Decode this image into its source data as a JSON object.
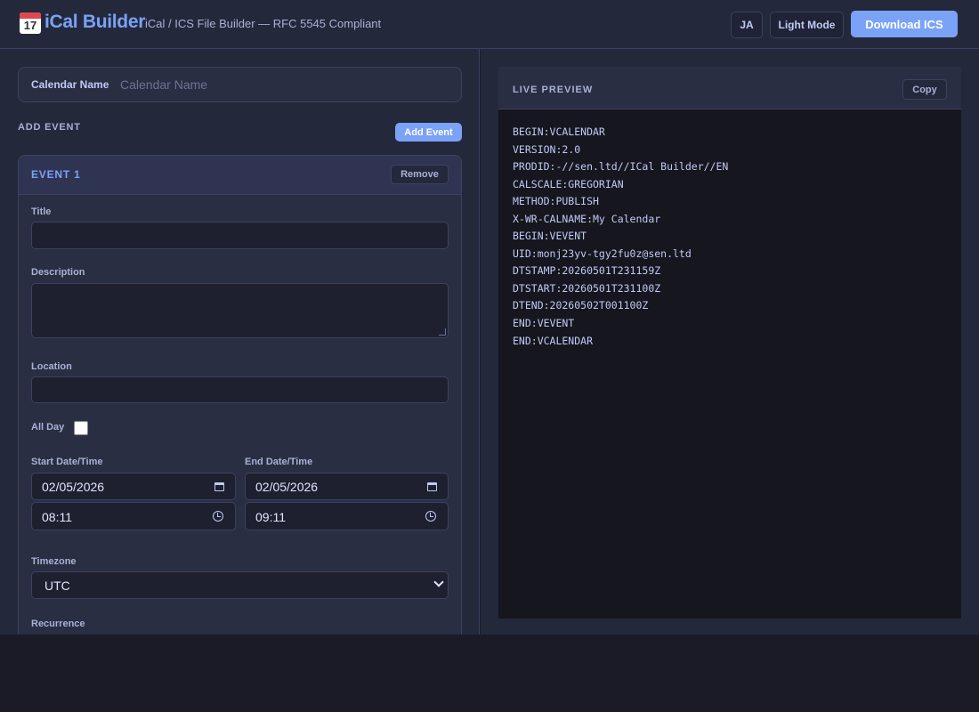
{
  "header": {
    "title": "iCal Builder",
    "subtitle": "iCal / ICS File Builder — RFC 5545 Compliant",
    "logo_day": "17",
    "lang_label": "JA",
    "theme_label": "Light Mode",
    "download_label": "Download ICS"
  },
  "calendar": {
    "name_label": "Calendar Name",
    "name_placeholder": "Calendar Name",
    "name_value": ""
  },
  "events_section": {
    "title": "ADD EVENT",
    "add_label": "Add Event"
  },
  "event": {
    "heading": "EVENT 1",
    "remove_label": "Remove",
    "title_label": "Title",
    "title_value": "",
    "description_label": "Description",
    "description_value": "",
    "location_label": "Location",
    "location_value": "",
    "all_day_label": "All Day",
    "all_day_checked": false,
    "start_label": "Start Date/Time",
    "start_date": "02/05/2026",
    "start_time": "08:11",
    "end_label": "End Date/Time",
    "end_date": "02/05/2026",
    "end_time": "09:11",
    "timezone_label": "Timezone",
    "timezone_value": "UTC",
    "recurrence_label": "Recurrence"
  },
  "preview": {
    "title": "LIVE PREVIEW",
    "copy_label": "Copy",
    "lines": [
      "BEGIN:VCALENDAR",
      "VERSION:2.0",
      "PRODID:-//sen.ltd//ICal Builder//EN",
      "CALSCALE:GREGORIAN",
      "METHOD:PUBLISH",
      "X-WR-CALNAME:My Calendar",
      "BEGIN:VEVENT",
      "UID:monj23yv-tgy2fu0z@sen.ltd",
      "DTSTAMP:20260501T231159Z",
      "DTSTART:20260501T231100Z",
      "DTEND:20260502T001100Z",
      "END:VEVENT",
      "END:VCALENDAR"
    ]
  },
  "colors": {
    "accent": "#7aa2f7",
    "background": "#1a1b26",
    "panel": "#24283b",
    "code_background": "#16161e"
  }
}
